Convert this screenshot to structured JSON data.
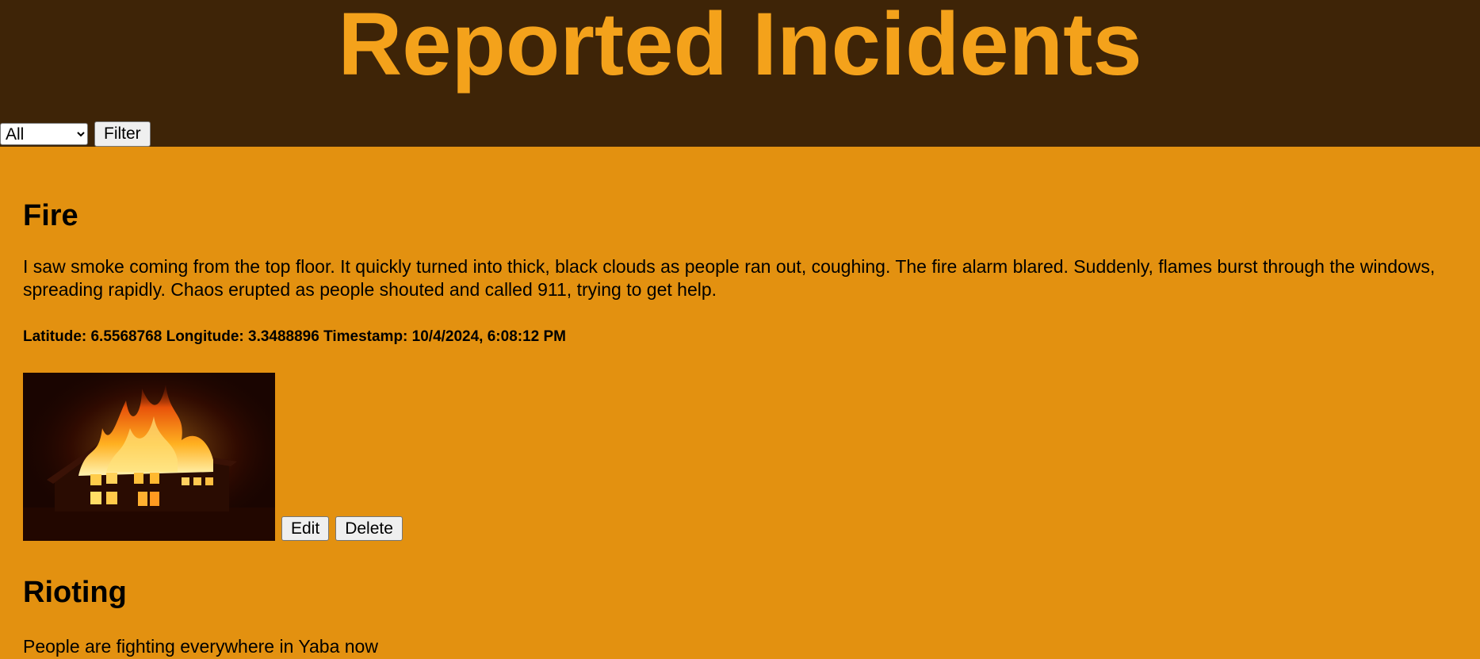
{
  "header": {
    "title": "Reported Incidents"
  },
  "filter": {
    "selected": "All",
    "options": [
      "All"
    ],
    "button_label": "Filter"
  },
  "incidents": [
    {
      "type": "Fire",
      "description": "I saw smoke coming from the top floor. It quickly turned into thick, black clouds as people ran out, coughing. The fire alarm blared. Suddenly, flames burst through the windows, spreading rapidly. Chaos erupted as people shouted and called 911, trying to get help.",
      "meta": "Latitude: 6.5568768 Longitude: 3.3488896 Timestamp: 10/4/2024, 6:08:12 PM",
      "edit_label": "Edit",
      "delete_label": "Delete"
    },
    {
      "type": "Rioting",
      "description": "People are fighting everywhere in Yaba now"
    }
  ],
  "colors": {
    "header_bg": "#3e2407",
    "title": "#f4a21b",
    "page_bg": "#e39110"
  }
}
